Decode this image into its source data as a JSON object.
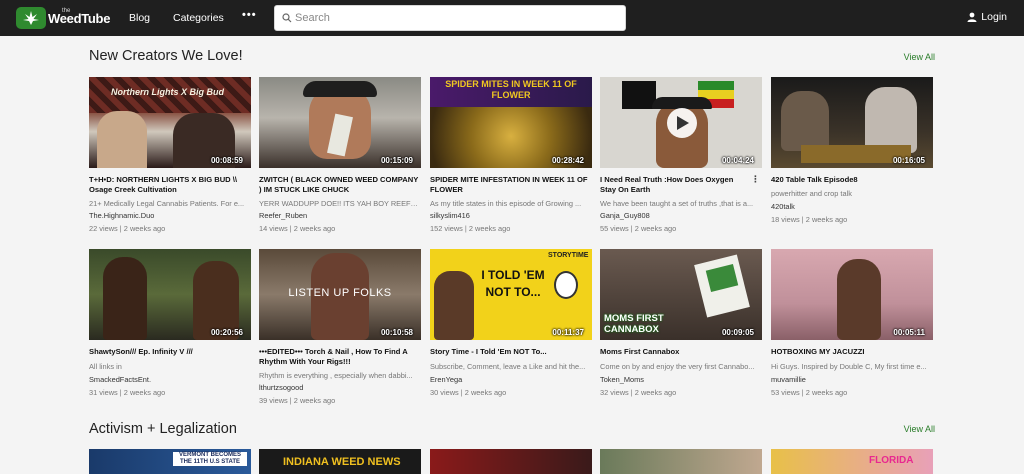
{
  "header": {
    "logo_small": "the",
    "logo_text": "WeedTube",
    "nav": [
      "Blog",
      "Categories"
    ],
    "more": "•••",
    "search_placeholder": "Search",
    "login": "Login"
  },
  "sections": [
    {
      "title": "New Creators We Love!",
      "view_all": "View All",
      "videos": [
        {
          "title": "T+H•D: NORTHERN LIGHTS X BIG BUD \\\\ Osage Creek Cultivation",
          "desc": "21+ Medically Legal Cannabis Patients. For e...",
          "channel": "The.Highnamic.Duo",
          "meta": "22 views | 2 weeks ago",
          "duration": "00:08:59",
          "thumb_text": "Northern Lights X Big Bud"
        },
        {
          "title": "ZWITCH ( BLACK OWNED WEED COMPANY ) IM STUCK LIKE CHUCK",
          "desc": "YERR WADDUPP DOE!! ITS YAH BOY REEF AN...",
          "channel": "Reefer_Ruben",
          "meta": "14 views | 2 weeks ago",
          "duration": "00:15:09"
        },
        {
          "title": "SPIDER MITE INFESTATION IN WEEK 11 OF FLOWER",
          "desc": "As my title states in this episode of Growing ...",
          "channel": "silkyslim416",
          "meta": "152 views | 2 weeks ago",
          "duration": "00:28:42",
          "thumb_text": "SPIDER MITES IN WEEK 11 OF FLOWER"
        },
        {
          "title": "I Need Real Truth :How Does Oxygen Stay On Earth",
          "desc": "We have been taught a set of truths ,that is a...",
          "channel": "Ganja_Guy808",
          "meta": "55 views | 2 weeks ago",
          "duration": "00:04:24",
          "kebab": "⋮"
        },
        {
          "title": "420 Table Talk Episode8",
          "desc": "powerhitter and crop talk",
          "channel": "420talk",
          "meta": "18 views | 2 weeks ago",
          "duration": "00:16:05"
        },
        {
          "title": "ShawtySon/// Ep. Infinity V ///",
          "desc": "All links in",
          "channel": "SmackedFactsEnt.",
          "meta": "31 views | 2 weeks ago",
          "duration": "00:20:56"
        },
        {
          "title": "•••EDITED••• Torch & Nail , How To Find A Rhythm With Your Rigs!!!",
          "desc": "Rhythm is everything , especially when dabbi...",
          "channel": "lthurtzsogood",
          "meta": "39 views | 2 weeks ago",
          "duration": "00:10:58",
          "thumb_text": "LISTEN UP FOLKS"
        },
        {
          "title": "Story Time - I Told 'Em NOT To...",
          "desc": "Subscribe, Comment, leave a Like and hit the...",
          "channel": "ErenYega",
          "meta": "30 views | 2 weeks ago",
          "duration": "00:11:37",
          "thumb_text": "I TOLD 'EM NOT TO...",
          "thumb_tag": "STORYTIME"
        },
        {
          "title": "Moms First Cannabox",
          "desc": "Come on by and enjoy the very first Cannabo...",
          "channel": "Token_Moms",
          "meta": "32 views | 2 weeks ago",
          "duration": "00:09:05",
          "thumb_text": "MOMS FIRST CANNABOX"
        },
        {
          "title": "HOTBOXING MY JACUZZI",
          "desc": "Hi Guys. Inspired by Double C, My first time e...",
          "channel": "muvamillie",
          "meta": "53 views | 2 weeks ago",
          "duration": "00:05:11"
        }
      ]
    },
    {
      "title": "Activism + Legalization",
      "view_all": "View All",
      "videos": [
        {
          "thumb_text": "VERMONT BECOMES THE 11TH U.S STATE"
        },
        {
          "thumb_text": "INDIANA WEED NEWS"
        },
        {},
        {},
        {
          "thumb_text": "FLORIDA"
        }
      ]
    }
  ],
  "colors": {
    "topbar": "#1f1f1f",
    "accent": "#2a7d2a",
    "background": "#f4f4f4"
  }
}
